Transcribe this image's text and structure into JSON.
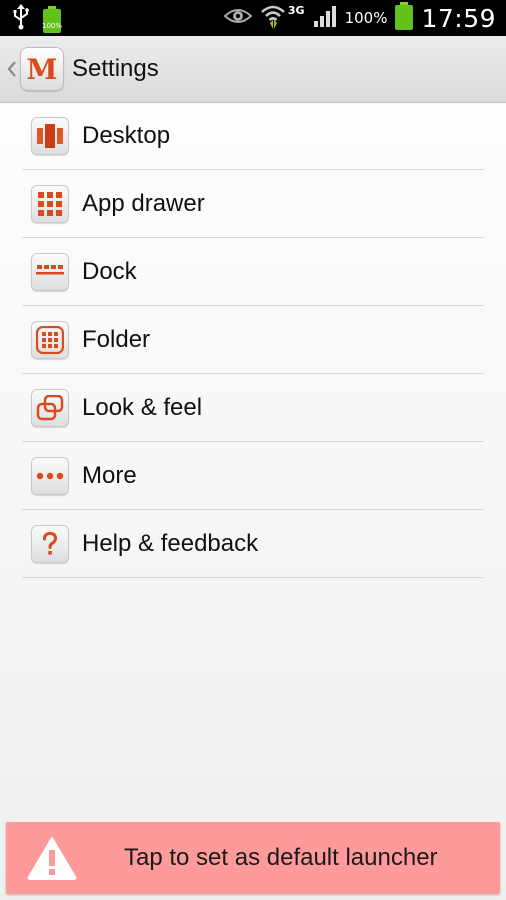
{
  "status_bar": {
    "battery_small_label": "100%",
    "battery_percent": "100%",
    "network_type": "3G",
    "time": "17:59"
  },
  "action_bar": {
    "app_icon_letter": "M",
    "title": "Settings"
  },
  "settings_list": [
    {
      "label": "Desktop",
      "icon": "desktop-icon"
    },
    {
      "label": "App drawer",
      "icon": "app-drawer-grid-icon"
    },
    {
      "label": "Dock",
      "icon": "dock-icon"
    },
    {
      "label": "Folder",
      "icon": "folder-grid-icon"
    },
    {
      "label": "Look & feel",
      "icon": "look-feel-icon"
    },
    {
      "label": "More",
      "icon": "more-dots-icon"
    },
    {
      "label": "Help & feedback",
      "icon": "help-question-icon"
    }
  ],
  "banner": {
    "text": "Tap to set as default launcher",
    "icon": "warning-icon"
  },
  "colors": {
    "accent": "#d94a1e",
    "banner_bg": "#ff9a9a",
    "status_bar_bg": "#000000"
  }
}
